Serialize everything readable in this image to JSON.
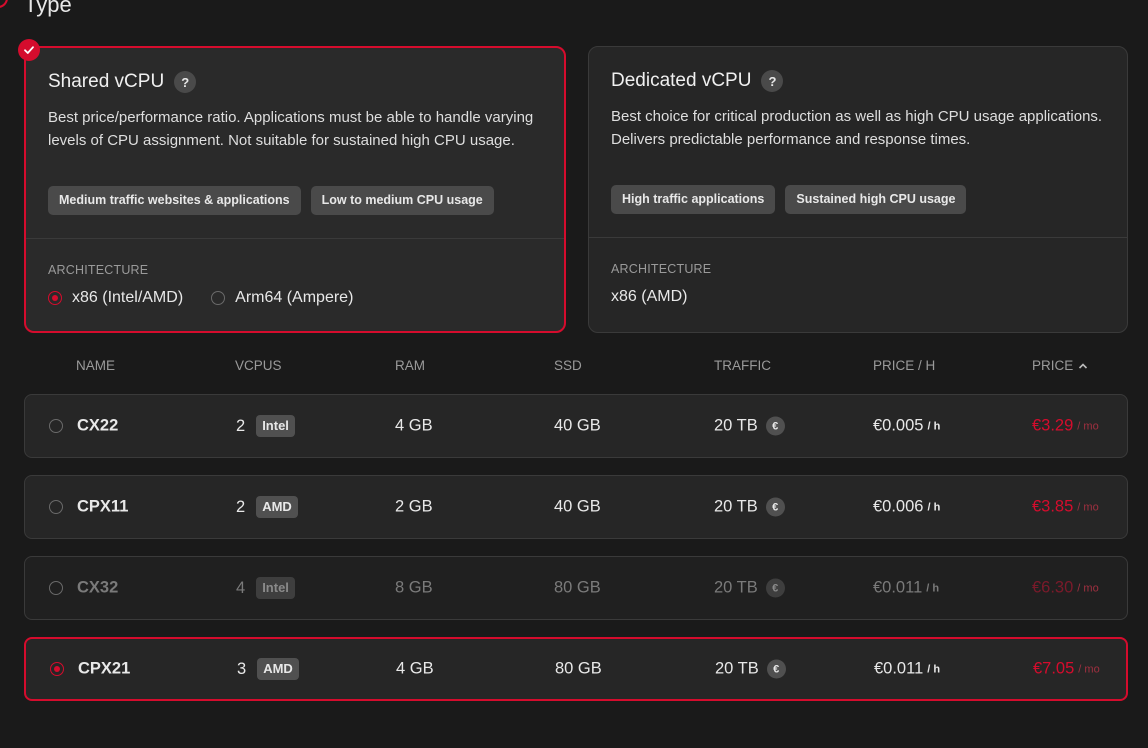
{
  "section": {
    "title": "Type"
  },
  "plans": {
    "shared": {
      "title": "Shared vCPU",
      "help": "?",
      "description": "Best price/performance ratio. Applications must be able to handle varying levels of CPU assignment. Not suitable for sustained high CPU usage.",
      "tags": [
        "Medium traffic websites & applications",
        "Low to medium CPU usage"
      ],
      "architecture_label": "ARCHITECTURE",
      "architecture_options": [
        "x86 (Intel/AMD)",
        "Arm64 (Ampere)"
      ],
      "architecture_selected": "x86 (Intel/AMD)",
      "selected": true
    },
    "dedicated": {
      "title": "Dedicated vCPU",
      "help": "?",
      "description": "Best choice for critical production as well as high CPU usage applications. Delivers predictable performance and response times.",
      "tags": [
        "High traffic applications",
        "Sustained high CPU usage"
      ],
      "architecture_label": "ARCHITECTURE",
      "architecture_value": "x86 (AMD)",
      "selected": false
    }
  },
  "table": {
    "headers": {
      "name": "NAME",
      "vcpus": "VCPUS",
      "ram": "RAM",
      "ssd": "SSD",
      "traffic": "TRAFFIC",
      "price_h": "PRICE / H",
      "price": "PRICE"
    },
    "sort": {
      "column": "price",
      "direction": "ascending"
    },
    "euro_symbol": "€",
    "hour_unit": "/ h",
    "month_unit": "/ mo",
    "rows": [
      {
        "name": "CX22",
        "vcpus": "2",
        "cpu": "Intel",
        "ram": "4 GB",
        "ssd": "40 GB",
        "traffic": "20 TB",
        "price_h": "€0.005",
        "price": "€3.29",
        "selected": false,
        "disabled": false
      },
      {
        "name": "CPX11",
        "vcpus": "2",
        "cpu": "AMD",
        "ram": "2 GB",
        "ssd": "40 GB",
        "traffic": "20 TB",
        "price_h": "€0.006",
        "price": "€3.85",
        "selected": false,
        "disabled": false
      },
      {
        "name": "CX32",
        "vcpus": "4",
        "cpu": "Intel",
        "ram": "8 GB",
        "ssd": "80 GB",
        "traffic": "20 TB",
        "price_h": "€0.011",
        "price": "€6.30",
        "selected": false,
        "disabled": true
      },
      {
        "name": "CPX21",
        "vcpus": "3",
        "cpu": "AMD",
        "ram": "4 GB",
        "ssd": "80 GB",
        "traffic": "20 TB",
        "price_h": "€0.011",
        "price": "€7.05",
        "selected": true,
        "disabled": false
      }
    ]
  },
  "colors": {
    "accent": "#d50c2d",
    "background": "#1a1a1a",
    "card": "#262626",
    "badge": "#4a4a4a"
  }
}
